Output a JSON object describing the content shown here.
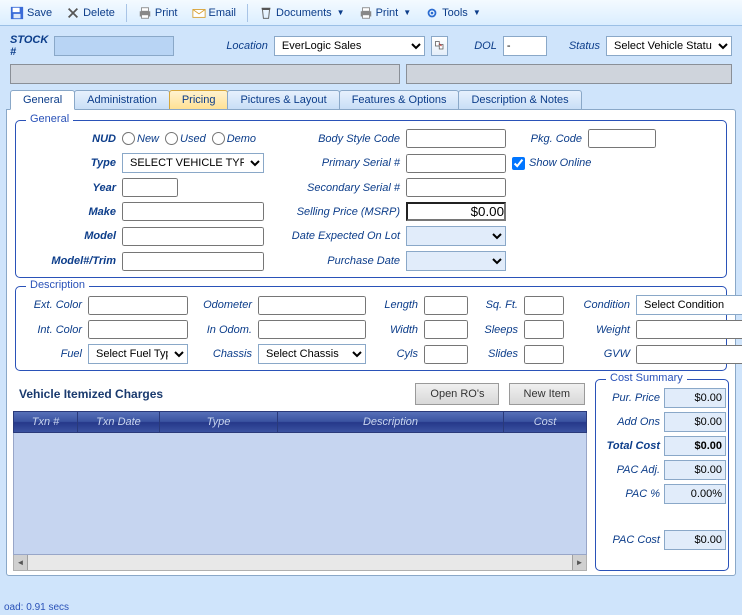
{
  "toolbar": {
    "save": "Save",
    "delete": "Delete",
    "print1": "Print",
    "email": "Email",
    "documents": "Documents",
    "print2": "Print",
    "tools": "Tools"
  },
  "header": {
    "stock_label": "STOCK #",
    "stock_value": "",
    "location_label": "Location",
    "location_value": "EverLogic Sales",
    "dol_label": "DOL",
    "dol_value": "-",
    "status_label": "Status",
    "status_value": "Select Vehicle Status"
  },
  "tabs": {
    "general": "General",
    "admin": "Administration",
    "pricing": "Pricing",
    "pictures": "Pictures & Layout",
    "features": "Features & Options",
    "desc": "Description & Notes"
  },
  "general": {
    "legend": "General",
    "nud_label": "NUD",
    "nud_new": "New",
    "nud_used": "Used",
    "nud_demo": "Demo",
    "type_label": "Type",
    "type_value": "SELECT VEHICLE TYPE",
    "year_label": "Year",
    "year_value": "",
    "make_label": "Make",
    "make_value": "",
    "model_label": "Model",
    "model_value": "",
    "trim_label": "Model#/Trim",
    "trim_value": "",
    "body_label": "Body Style Code",
    "body_value": "",
    "primary_label": "Primary Serial #",
    "primary_value": "",
    "secondary_label": "Secondary Serial #",
    "secondary_value": "",
    "msrp_label": "Selling Price (MSRP)",
    "msrp_value": "$0.00",
    "expected_label": "Date Expected On Lot",
    "expected_value": "",
    "purchase_label": "Purchase Date",
    "purchase_value": "",
    "pkg_label": "Pkg. Code",
    "pkg_value": "",
    "show_online_label": "Show Online"
  },
  "description": {
    "legend": "Description",
    "ext_color_label": "Ext. Color",
    "ext_color_value": "",
    "int_color_label": "Int. Color",
    "int_color_value": "",
    "fuel_label": "Fuel",
    "fuel_value": "Select Fuel Type",
    "odometer_label": "Odometer",
    "odometer_value": "",
    "in_odom_label": "In Odom.",
    "in_odom_value": "",
    "chassis_label": "Chassis",
    "chassis_value": "Select Chassis",
    "length_label": "Length",
    "length_value": "",
    "width_label": "Width",
    "width_value": "",
    "cyls_label": "Cyls",
    "cyls_value": "",
    "sqft_label": "Sq. Ft.",
    "sqft_value": "",
    "sleeps_label": "Sleeps",
    "sleeps_value": "",
    "slides_label": "Slides",
    "slides_value": "",
    "condition_label": "Condition",
    "condition_value": "Select Condition",
    "weight_label": "Weight",
    "weight_value": "",
    "gvw_label": "GVW",
    "gvw_value": ""
  },
  "charges": {
    "title": "Vehicle Itemized Charges",
    "open_ros": "Open RO's",
    "new_item": "New Item",
    "cols": {
      "txn_no": "Txn #",
      "txn_date": "Txn Date",
      "type": "Type",
      "description": "Description",
      "cost": "Cost"
    }
  },
  "cost_summary": {
    "legend": "Cost Summary",
    "pur_price_label": "Pur. Price",
    "pur_price_value": "$0.00",
    "add_ons_label": "Add Ons",
    "add_ons_value": "$0.00",
    "total_cost_label": "Total Cost",
    "total_cost_value": "$0.00",
    "pac_adj_label": "PAC Adj.",
    "pac_adj_value": "$0.00",
    "pac_pct_label": "PAC %",
    "pac_pct_value": "0.00%",
    "pac_cost_label": "PAC Cost",
    "pac_cost_value": "$0.00"
  },
  "footer": {
    "status": "oad: 0.91 secs"
  }
}
